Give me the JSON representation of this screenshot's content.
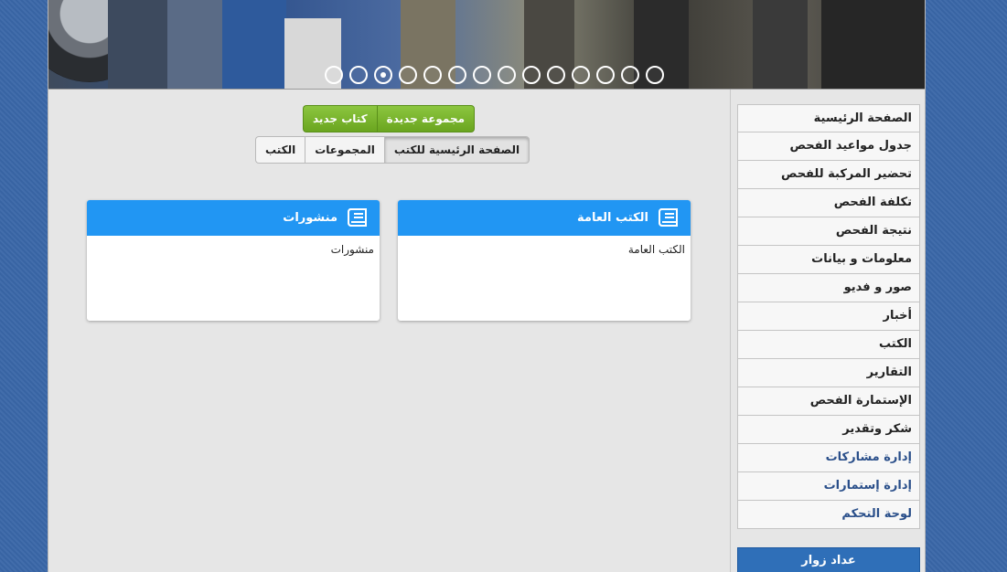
{
  "banner": {
    "slide_count": 14,
    "active_index": 2
  },
  "toolbar": {
    "new_group_label": "مجموعة جديدة",
    "new_book_label": "كتاب جديد"
  },
  "tabs": [
    {
      "label": "الصفحة الرئيسية للكتب",
      "active": true
    },
    {
      "label": "المجموعات",
      "active": false
    },
    {
      "label": "الكتب",
      "active": false
    }
  ],
  "cards": [
    {
      "title": "الكتب العامة",
      "body": "الكتب العامة",
      "icon": "book-icon"
    },
    {
      "title": "منشورات",
      "body": "منشورات",
      "icon": "book-icon"
    }
  ],
  "sidebar": {
    "items": [
      {
        "label": "الصفحة الرئيسية"
      },
      {
        "label": "جدول مواعيد الفحص"
      },
      {
        "label": "تحضير المركبة للفحص"
      },
      {
        "label": "تكلفة الفحص"
      },
      {
        "label": "نتيجة الفحص"
      },
      {
        "label": "معلومات و بيانات"
      },
      {
        "label": "صور و فديو"
      },
      {
        "label": "أخبار"
      },
      {
        "label": "الكتب"
      },
      {
        "label": "التقارير"
      },
      {
        "label": "الإستمارة الفحص"
      },
      {
        "label": "شكر وتقدير"
      },
      {
        "label": "إدارة مشاركات"
      },
      {
        "label": "إدارة إستمارات"
      },
      {
        "label": "لوحة التحكم"
      }
    ],
    "counter_title": "عداد زوار"
  },
  "colors": {
    "card_header": "#2196f3",
    "green_button": "#7ab52b",
    "counter_header": "#2f6fb8",
    "body_bg": "#3a67a8"
  }
}
